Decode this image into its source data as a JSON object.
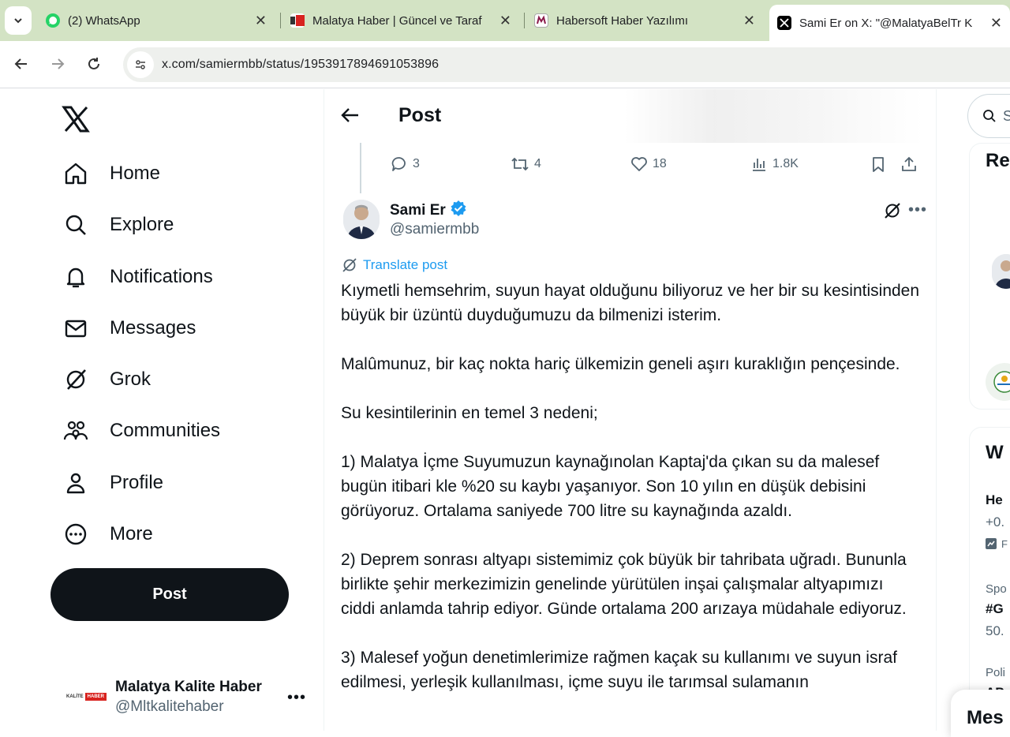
{
  "browser": {
    "tabs": [
      {
        "title": "(2) WhatsApp",
        "icon": "whatsapp-icon",
        "color": "#25d366"
      },
      {
        "title": "Malatya Haber | Güncel ve Taraf",
        "icon": "malatya-haber-icon",
        "color": "#d8231f"
      },
      {
        "title": "Habersoft Haber Yazılımı",
        "icon": "habersoft-icon",
        "color": "#8b1a4a"
      },
      {
        "title": "Sami Er on X: \"@MalatyaBelTr K",
        "icon": "x-icon",
        "color": "#000000"
      }
    ],
    "url": "x.com/samiermbb/status/1953917894691053896"
  },
  "nav": {
    "items": [
      {
        "label": "Home",
        "icon": "home-icon"
      },
      {
        "label": "Explore",
        "icon": "search-icon"
      },
      {
        "label": "Notifications",
        "icon": "bell-icon"
      },
      {
        "label": "Messages",
        "icon": "mail-icon"
      },
      {
        "label": "Grok",
        "icon": "grok-icon"
      },
      {
        "label": "Communities",
        "icon": "communities-icon"
      },
      {
        "label": "Profile",
        "icon": "profile-icon"
      },
      {
        "label": "More",
        "icon": "more-circle-icon"
      }
    ],
    "post_button": "Post",
    "account": {
      "name": "Malatya Kalite Haber",
      "handle": "@Mltkalitehaber",
      "logo_text_a": "KALİTE",
      "logo_text_b": "HABER"
    }
  },
  "main": {
    "header_title": "Post",
    "prev_actions": {
      "replies": "3",
      "reposts": "4",
      "likes": "18",
      "views": "1.8K"
    },
    "author": {
      "name": "Sami Er",
      "handle": "@samiermbb",
      "verified_color": "#1d9bf0"
    },
    "translate_label": "Translate post",
    "paragraphs": [
      "Kıymetli hemsehrim, suyun hayat olduğunu biliyoruz ve her bir su kesintisinden büyük bir üzüntü duyduğumuzu da bilmenizi isterim.",
      "Malûmunuz, bir kaç nokta hariç ülkemizin geneli aşırı kuraklığın pençesinde.",
      "Su kesintilerinin en temel 3 nedeni;",
      "1) Malatya İçme Suyumuzun kaynağınolan Kaptaj'da çıkan su da malesef bugün itibari kle %20 su kaybı yaşanıyor. Son 10 yılın en düşük debisini görüyoruz. Ortalama saniyede 700 litre su kaynağında azaldı.",
      "2) Deprem sonrası altyapı sistemimiz çok büyük bir tahribata uğradı. Bununla birlikte şehir merkezimizin genelinde yürütülen inşai çalışmalar altyapımızı ciddi anlamda tahrip ediyor. Günde ortalama 200 arızaya müdahale ediyoruz.",
      "3) Malesef yoğun denetimlerimize rağmen kaçak su kullanımı ve suyun israf edilmesi, yerleşik kullanılması, içme suyu ile tarımsal sulamanın"
    ]
  },
  "right": {
    "search_placeholder": "S",
    "card1_title": "Re",
    "card2_title": "W",
    "trends": [
      {
        "label": "He",
        "sub": "+0.",
        "sub2": "F"
      },
      {
        "label": "Spo",
        "sub": "#G",
        "sub2": "50."
      },
      {
        "label": "Poli",
        "sub": "AP"
      }
    ],
    "messages_label": "Mes"
  }
}
